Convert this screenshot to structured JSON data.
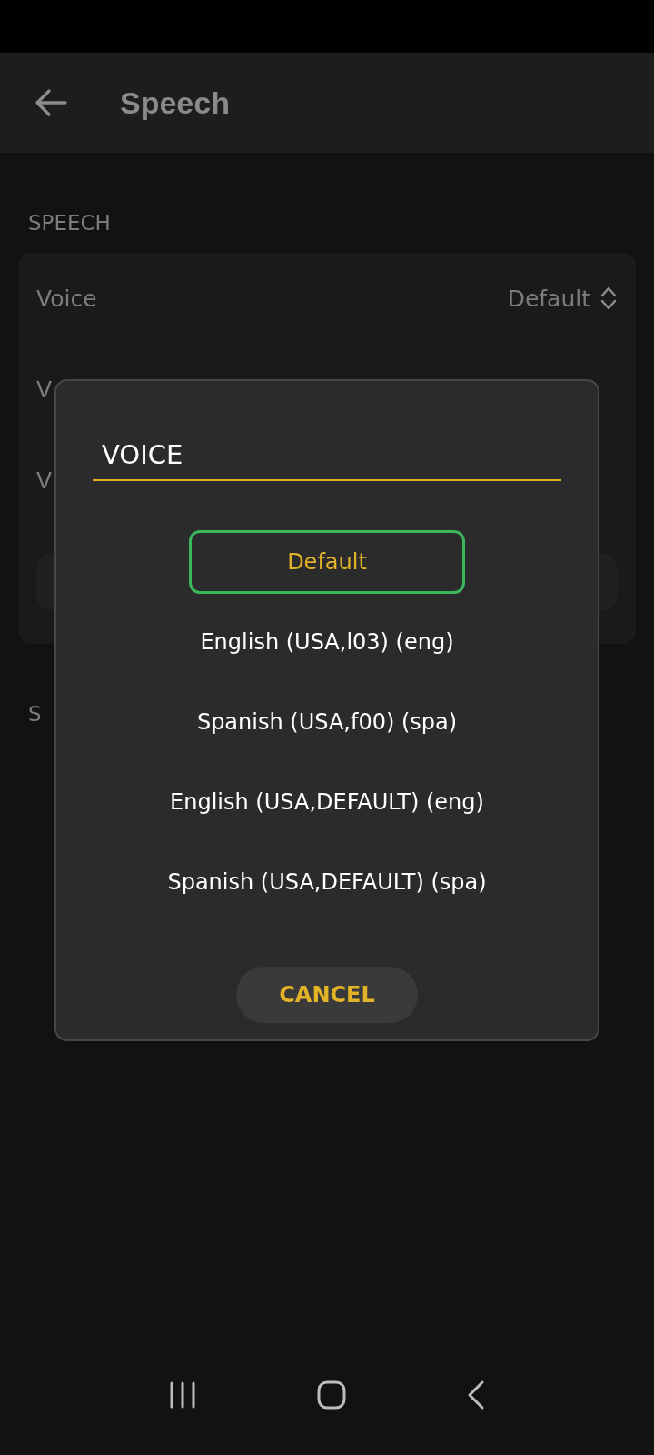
{
  "app_bar": {
    "title": "Speech"
  },
  "sections": [
    {
      "header": "SPEECH",
      "rows": [
        {
          "kind": "select",
          "label": "Voice",
          "value": "Default"
        },
        {
          "kind": "text",
          "label": "V"
        },
        {
          "kind": "text",
          "label": "V"
        },
        {
          "kind": "pill"
        }
      ]
    },
    {
      "header": "S"
    }
  ],
  "dialog": {
    "title": "VOICE",
    "options": [
      {
        "label": "Default",
        "selected": true
      },
      {
        "label": "English (USA,l03) (eng)",
        "selected": false
      },
      {
        "label": "Spanish (USA,f00) (spa)",
        "selected": false
      },
      {
        "label": "English (USA,DEFAULT) (eng)",
        "selected": false
      },
      {
        "label": "Spanish (USA,DEFAULT) (spa)",
        "selected": false
      }
    ],
    "cancel": "CANCEL"
  }
}
